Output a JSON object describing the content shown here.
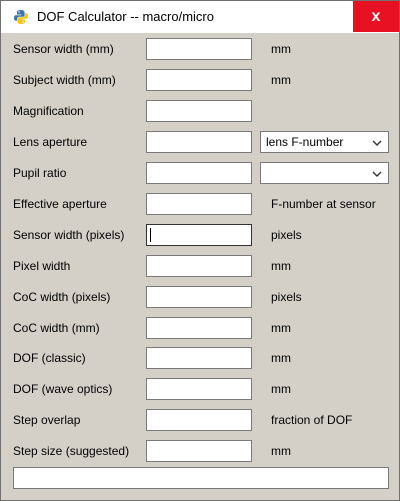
{
  "window": {
    "title": "DOF Calculator -- macro/micro",
    "close_label": "x"
  },
  "rows": [
    {
      "label": "Sensor width (mm)",
      "value": "",
      "unit": "mm"
    },
    {
      "label": "Subject width (mm)",
      "value": "",
      "unit": "mm"
    },
    {
      "label": "Magnification",
      "value": "",
      "unit": ""
    },
    {
      "label": "Lens aperture",
      "value": "",
      "unit": ""
    },
    {
      "label": "Pupil ratio",
      "value": "",
      "unit": ""
    },
    {
      "label": "Effective aperture",
      "value": "",
      "unit": "F-number at sensor"
    },
    {
      "label": "Sensor width (pixels)",
      "value": "",
      "unit": "pixels"
    },
    {
      "label": "Pixel width",
      "value": "",
      "unit": "mm"
    },
    {
      "label": "CoC width (pixels)",
      "value": "",
      "unit": "pixels"
    },
    {
      "label": "CoC width (mm)",
      "value": "",
      "unit": "mm"
    },
    {
      "label": "DOF (classic)",
      "value": "",
      "unit": "mm"
    },
    {
      "label": "DOF (wave optics)",
      "value": "",
      "unit": "mm"
    },
    {
      "label": "Step overlap",
      "value": "",
      "unit": "fraction of DOF"
    },
    {
      "label": "Step size (suggested)",
      "value": "",
      "unit": "mm"
    }
  ],
  "aperture_select": {
    "selected": "lens F-number"
  },
  "pupil_select": {
    "selected": ""
  },
  "status": {
    "text": ""
  },
  "icons": {
    "app": "python-icon",
    "chevron": "chevron-down-icon"
  },
  "colors": {
    "close_bg": "#e81123",
    "window_bg": "#d4d0c8"
  }
}
